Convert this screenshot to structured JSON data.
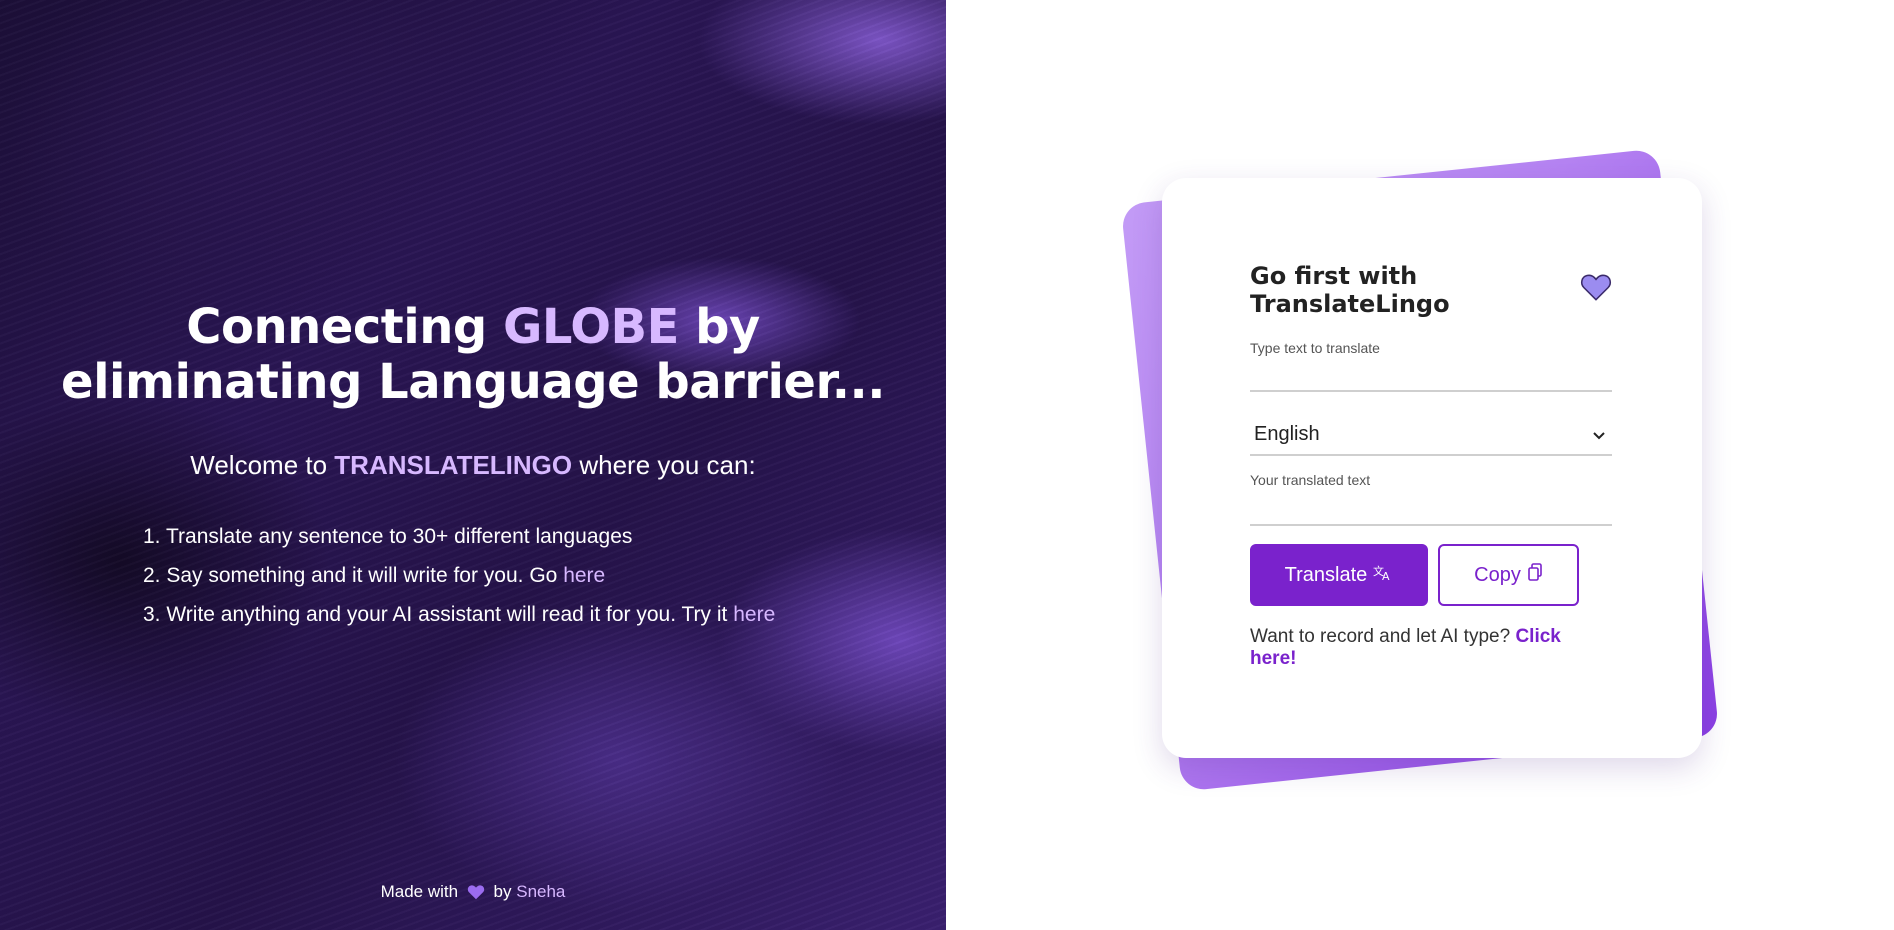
{
  "hero": {
    "headline_part1": "Connecting ",
    "headline_accent": "GLOBE",
    "headline_part2": " by",
    "headline_line2": "eliminating Language barrier...",
    "welcome_prefix": "Welcome to ",
    "welcome_brand": "TRANSLATELINGO",
    "welcome_suffix": " where you can:",
    "features": [
      {
        "text": "1. Translate any sentence to 30+ different languages",
        "link": ""
      },
      {
        "text": "2. Say something and it will write for you. Go ",
        "link": "here"
      },
      {
        "text": "3. Write anything and your AI assistant will read it for you. Try it ",
        "link": "here"
      }
    ]
  },
  "footer": {
    "made_with": "Made with",
    "by": "by",
    "author": "Sneha"
  },
  "card": {
    "title": "Go first with TranslateLingo",
    "input_label": "Type text to translate",
    "input_value": "",
    "language_selected": "English",
    "output_label": "Your translated text",
    "translate_button": "Translate",
    "copy_button": "Copy",
    "record_prompt": "Want to record and let AI type?",
    "record_link": "Click here!"
  },
  "icons": {
    "heart": "heart-icon",
    "translate": "translate-icon",
    "copy": "copy-icon",
    "chevron": "chevron-down-icon"
  },
  "colors": {
    "accent_light": "#d7b8ff",
    "primary_purple": "#7a22cc",
    "heart_purple": "#9b6cf0",
    "hero_dark": "#1c0f38"
  }
}
